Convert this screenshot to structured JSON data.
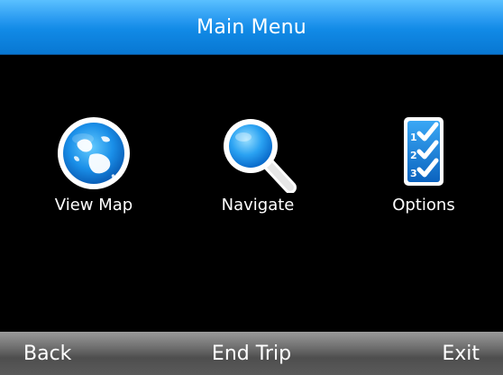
{
  "header": {
    "title": "Main Menu"
  },
  "menu": {
    "items": [
      {
        "label": "View Map",
        "icon": "globe-icon"
      },
      {
        "label": "Navigate",
        "icon": "magnifier-icon"
      },
      {
        "label": "Options",
        "icon": "checklist-icon"
      }
    ]
  },
  "softkeys": {
    "left": "Back",
    "center": "End Trip",
    "right": "Exit"
  },
  "colors": {
    "titlebar_top": "#5ac0ff",
    "titlebar_bottom": "#0877d2",
    "background": "#000000",
    "softkey_bar": "#5a5a5a",
    "icon_blue": "#1e90ff"
  }
}
